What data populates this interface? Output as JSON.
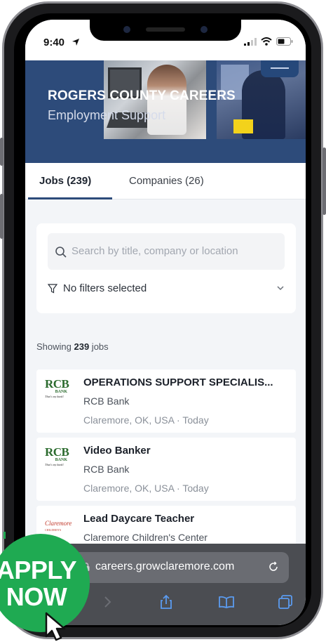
{
  "status_bar": {
    "time": "9:40"
  },
  "header": {
    "title": "ROGERS COUNTY CAREERS",
    "subtitle": "Employment Support"
  },
  "tabs": [
    {
      "label": "Jobs (239)",
      "active": true
    },
    {
      "label": "Companies (26)",
      "active": false
    }
  ],
  "search": {
    "placeholder": "Search by title, company or location"
  },
  "filters": {
    "label": "No filters selected"
  },
  "results": {
    "prefix": "Showing ",
    "count": "239",
    "suffix": " jobs"
  },
  "jobs": [
    {
      "title": "OPERATIONS SUPPORT SPECIALIS...",
      "company": "RCB Bank",
      "location": "Claremore, OK, USA",
      "posted": "Today",
      "logo": "rcb-bank-logo"
    },
    {
      "title": "Video Banker",
      "company": "RCB Bank",
      "location": "Claremore, OK, USA",
      "posted": "Today",
      "logo": "rcb-bank-logo"
    },
    {
      "title": "Lead Daycare Teacher",
      "company": "Claremore Children's Center",
      "location": "",
      "posted": "",
      "logo": "claremore-childrens-center-logo"
    }
  ],
  "logos": {
    "rcb_main": "RCB",
    "rcb_bank": "BANK",
    "rcb_tag": "That's my bank!",
    "claremore_main": "Claremore",
    "claremore_sub": "CHILDREN'S CENTER"
  },
  "browser": {
    "url": "careers.growclaremore.com"
  },
  "badge": {
    "line1": "APPLY",
    "line2": "NOW"
  },
  "colors": {
    "header_blue": "#2d4b7a",
    "badge_green": "#1faa52",
    "browser_bar": "#4b4d52"
  }
}
